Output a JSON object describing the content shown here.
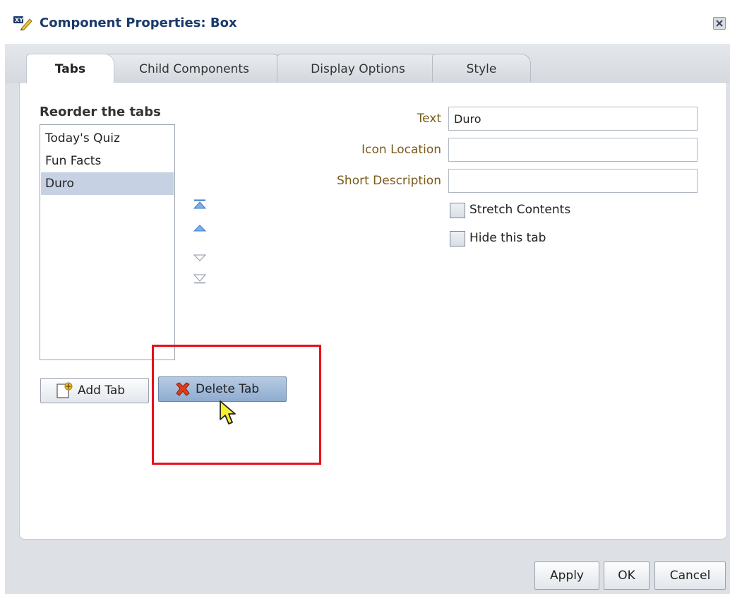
{
  "window": {
    "title": "Component Properties: Box"
  },
  "tabs": [
    {
      "label": "Tabs",
      "selected": true
    },
    {
      "label": "Child Components",
      "selected": false
    },
    {
      "label": "Display Options",
      "selected": false
    },
    {
      "label": "Style",
      "selected": false
    }
  ],
  "reorder": {
    "label": "Reorder the tabs",
    "items": [
      "Today's Quiz",
      "Fun Facts",
      "Duro"
    ],
    "selected_item": "Duro"
  },
  "buttons": {
    "add_tab": "Add Tab",
    "delete_tab": "Delete Tab"
  },
  "fields": {
    "text_label": "Text",
    "text_value": "Duro",
    "icon_location_label": "Icon Location",
    "icon_location_value": "",
    "short_description_label": "Short Description",
    "short_description_value": ""
  },
  "checkboxes": {
    "stretch_contents": {
      "label": "Stretch Contents",
      "checked": false
    },
    "hide_tab": {
      "label": "Hide this tab",
      "checked": false
    }
  },
  "footer": {
    "apply": "Apply",
    "ok": "OK",
    "cancel": "Cancel"
  },
  "colors": {
    "title_text": "#1b3a6b",
    "field_label": "#7a5a1a",
    "highlight_box": "#e8101a",
    "selected_row": "#c6d2e3",
    "arrow_active": "#3c7bc8",
    "arrow_inactive": "#8a96a6"
  },
  "icons": {
    "title": "xy-edit-icon",
    "close": "close-icon",
    "move_top": "move-to-top-icon",
    "move_up": "move-up-icon",
    "move_down": "move-down-icon",
    "move_bottom": "move-to-bottom-icon",
    "add": "add-tab-icon",
    "delete": "delete-x-icon",
    "cursor": "mouse-pointer-icon"
  }
}
